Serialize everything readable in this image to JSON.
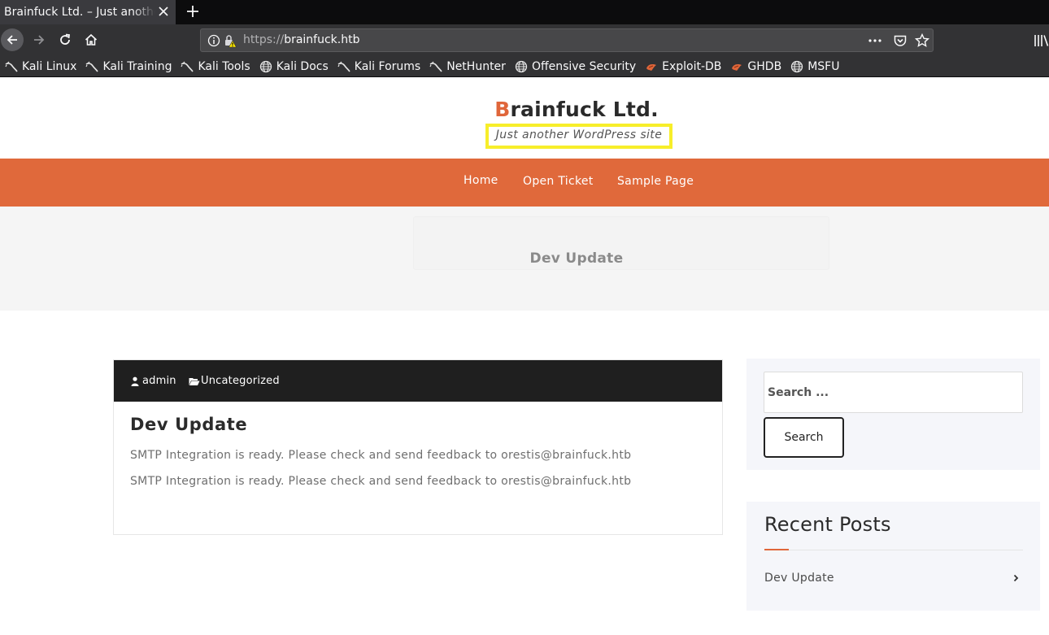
{
  "browser": {
    "tab_title": "Brainfuck Ltd. – Just another WordPress site",
    "url_scheme": "https://",
    "url_host": "brainfuck.htb",
    "bookmarks": [
      {
        "label": "Kali Linux",
        "icon": "kali-dragon-icon"
      },
      {
        "label": "Kali Training",
        "icon": "kali-dragon-icon"
      },
      {
        "label": "Kali Tools",
        "icon": "kali-dragon-icon"
      },
      {
        "label": "Kali Docs",
        "icon": "globe-icon"
      },
      {
        "label": "Kali Forums",
        "icon": "kali-dragon-icon"
      },
      {
        "label": "NetHunter",
        "icon": "kali-dragon-icon"
      },
      {
        "label": "Offensive Security",
        "icon": "globe-icon"
      },
      {
        "label": "Exploit-DB",
        "icon": "exploitdb-icon"
      },
      {
        "label": "GHDB",
        "icon": "exploitdb-icon"
      },
      {
        "label": "MSFU",
        "icon": "globe-icon"
      }
    ]
  },
  "site": {
    "title_first_letter": "B",
    "title_rest": "rainfuck Ltd.",
    "tagline": "Just another WordPress site",
    "accent_color": "#e0693b",
    "highlight_color": "#f7ee2a"
  },
  "nav": {
    "items": [
      "Home",
      "Open Ticket",
      "Sample Page"
    ]
  },
  "banner": {
    "title": "Dev Update"
  },
  "post": {
    "author": "admin",
    "category": "Uncategorized",
    "title": "Dev Update",
    "paragraphs": [
      "SMTP Integration is ready. Please check and send feedback to orestis@brainfuck.htb",
      "SMTP Integration is ready. Please check and send feedback to orestis@brainfuck.htb"
    ]
  },
  "sidebar": {
    "search_placeholder": "Search ...",
    "search_button": "Search",
    "recent_posts_title": "Recent Posts",
    "recent_posts": [
      "Dev Update"
    ]
  }
}
